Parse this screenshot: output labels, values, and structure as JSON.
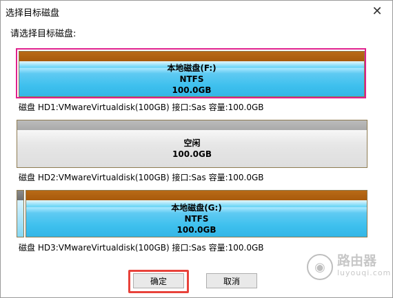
{
  "window": {
    "title": "选择目标磁盘",
    "prompt": "请选择目标磁盘:"
  },
  "disks": [
    {
      "partition": {
        "name": "本地磁盘(F:)",
        "fs": "NTFS",
        "size": "100.0GB"
      },
      "info": "磁盘 HD1:VMwareVirtualdisk(100GB)  接口:Sas  容量:100.0GB"
    },
    {
      "partition": {
        "name": "空闲",
        "size": "100.0GB"
      },
      "info": "磁盘 HD2:VMwareVirtualdisk(100GB)  接口:Sas  容量:100.0GB"
    },
    {
      "partition": {
        "name": "本地磁盘(G:)",
        "fs": "NTFS",
        "size": "100.0GB"
      },
      "info": "磁盘 HD3:VMwareVirtualdisk(100GB)  接口:Sas  容量:100.0GB"
    }
  ],
  "buttons": {
    "ok": "确定",
    "cancel": "取消"
  },
  "watermark": {
    "main": "路由器",
    "sub": "luyouqi.com"
  },
  "colors": {
    "ntfs_top": "#a85a0c",
    "ntfs_body": "#3ec0ee",
    "selection": "#e0208c",
    "highlight": "#e8423a"
  }
}
